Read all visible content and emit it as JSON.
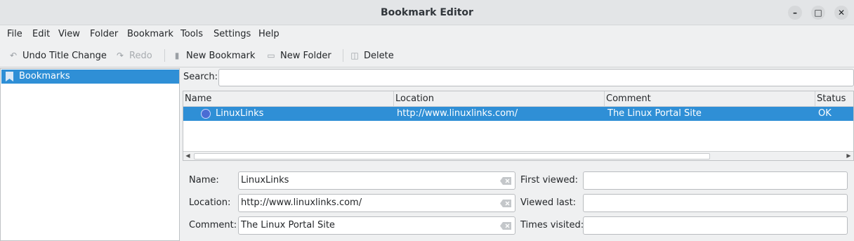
{
  "window": {
    "title": "Bookmark Editor"
  },
  "menubar": {
    "items": [
      {
        "label": "File"
      },
      {
        "label": "Edit"
      },
      {
        "label": "View"
      },
      {
        "label": "Folder"
      },
      {
        "label": "Bookmark"
      },
      {
        "label": "Tools"
      },
      {
        "label": "Settings"
      },
      {
        "label": "Help"
      }
    ]
  },
  "toolbar": {
    "undo_label": "Undo Title Change",
    "redo_label": "Redo",
    "new_bookmark_label": "New Bookmark",
    "new_folder_label": "New Folder",
    "delete_label": "Delete"
  },
  "tree": {
    "root_label": "Bookmarks"
  },
  "search": {
    "label": "Search:",
    "value": ""
  },
  "table": {
    "columns": [
      "Name",
      "Location",
      "Comment",
      "Status"
    ],
    "rows": [
      {
        "name": "LinuxLinks",
        "location": "http://www.linuxlinks.com/",
        "comment": "The Linux Portal Site",
        "status": "OK"
      }
    ]
  },
  "details": {
    "name_label": "Name:",
    "name_value": "LinuxLinks",
    "location_label": "Location:",
    "location_value": "http://www.linuxlinks.com/",
    "comment_label": "Comment:",
    "comment_value": "The Linux Portal Site",
    "first_viewed_label": "First viewed:",
    "first_viewed_value": "",
    "viewed_last_label": "Viewed last:",
    "viewed_last_value": "",
    "times_visited_label": "Times visited:",
    "times_visited_value": ""
  },
  "colors": {
    "selection": "#2f8fd6",
    "window_bg": "#eff0f1"
  }
}
